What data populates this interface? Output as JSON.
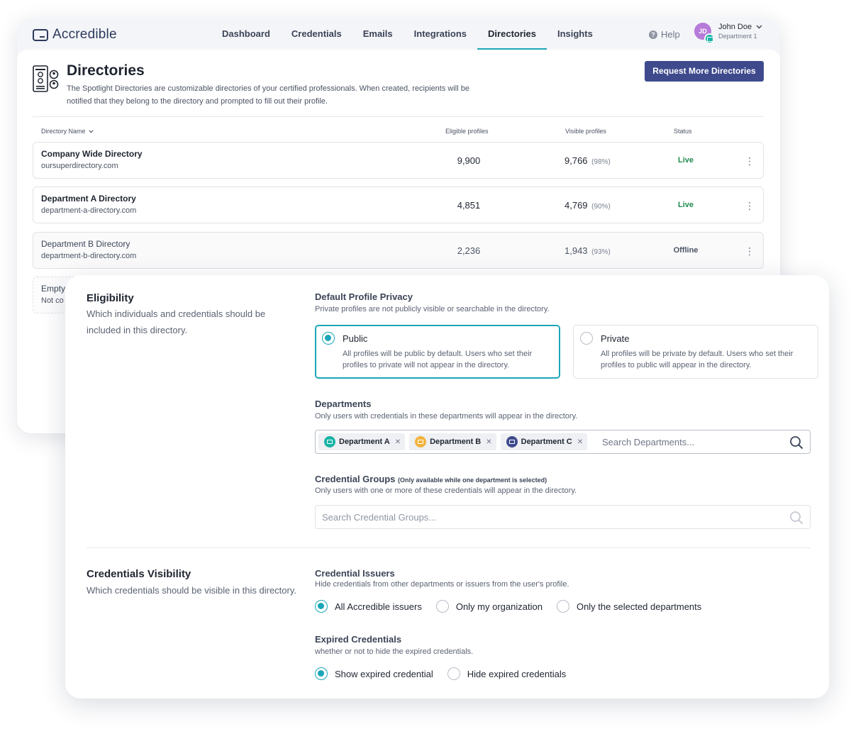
{
  "nav": {
    "logo_text": "Accredible",
    "items": [
      "Dashboard",
      "Credentials",
      "Emails",
      "Integrations",
      "Directories",
      "Insights"
    ],
    "help_label": "Help",
    "user": {
      "initials": "JD",
      "name": "John Doe",
      "department": "Department 1"
    }
  },
  "page": {
    "title": "Directories",
    "description": "The Spotlight Directories are customizable directories of your certified professionals. When created, recipients will be notified that they belong to the directory and prompted to fill out their profile.",
    "request_button": "Request More Directories",
    "columns": {
      "name": "Directory Name",
      "eligible": "Eligible profiles",
      "visible": "Visible profiles",
      "status": "Status"
    },
    "rows": [
      {
        "name": "Company Wide Directory",
        "url": "oursuperdirectory.com",
        "eligible": "9,900",
        "visible": "9,766",
        "pct": "(98%)",
        "status": "Live"
      },
      {
        "name": "Department A Directory",
        "url": "department-a-directory.com",
        "eligible": "4,851",
        "visible": "4,769",
        "pct": "(90%)",
        "status": "Live"
      },
      {
        "name": "Department B Directory",
        "url": "department-b-directory.com",
        "eligible": "2,236",
        "visible": "1,943",
        "pct": "(93%)",
        "status": "Offline"
      }
    ],
    "empty_row": {
      "name": "Empty",
      "url": "Not co"
    }
  },
  "eligibility": {
    "title": "Eligibility",
    "description": "Which individuals and credentials should be included in this directory.",
    "privacy": {
      "label": "Default Profile Privacy",
      "help": "Private profiles are not publicly visible or searchable in the directory.",
      "options": [
        {
          "title": "Public",
          "desc": "All profiles will be public by default. Users who set their profiles to private will not appear in the directory."
        },
        {
          "title": "Private",
          "desc": "All profiles will be private by default. Users who set their profiles to public will appear in the directory."
        }
      ]
    },
    "departments": {
      "label": "Departments",
      "help": "Only users with credentials in these departments will appear in the directory.",
      "chips": [
        "Department A",
        "Department B",
        "Department C"
      ],
      "placeholder": "Search Departments..."
    },
    "groups": {
      "label": "Credential Groups",
      "label_note": "(Only available while one department is selected)",
      "help": "Only users with one or more of these credentials will appear in the directory.",
      "placeholder": "Search Credential Groups..."
    }
  },
  "visibility": {
    "title": "Credentials Visibility",
    "description": "Which credentials should be visible in this directory.",
    "issuers": {
      "label": "Credential Issuers",
      "help": "Hide credentials from other departments or issuers from the user's profile.",
      "options": [
        "All Accredible issuers",
        "Only my organization",
        "Only the selected departments"
      ]
    },
    "expired": {
      "label": "Expired Credentials",
      "help": "whether or not to hide the expired credentials.",
      "options": [
        "Show expired credential",
        "Hide expired credentials"
      ]
    }
  },
  "colors": {
    "accent": "#1aa6b7",
    "primary_button": "#3f4a8d",
    "live": "#1f8a4c",
    "chip_a": "#19b3a6",
    "chip_b": "#f2b33d",
    "chip_c": "#3f4a8d",
    "avatar": "#b77bd9"
  }
}
